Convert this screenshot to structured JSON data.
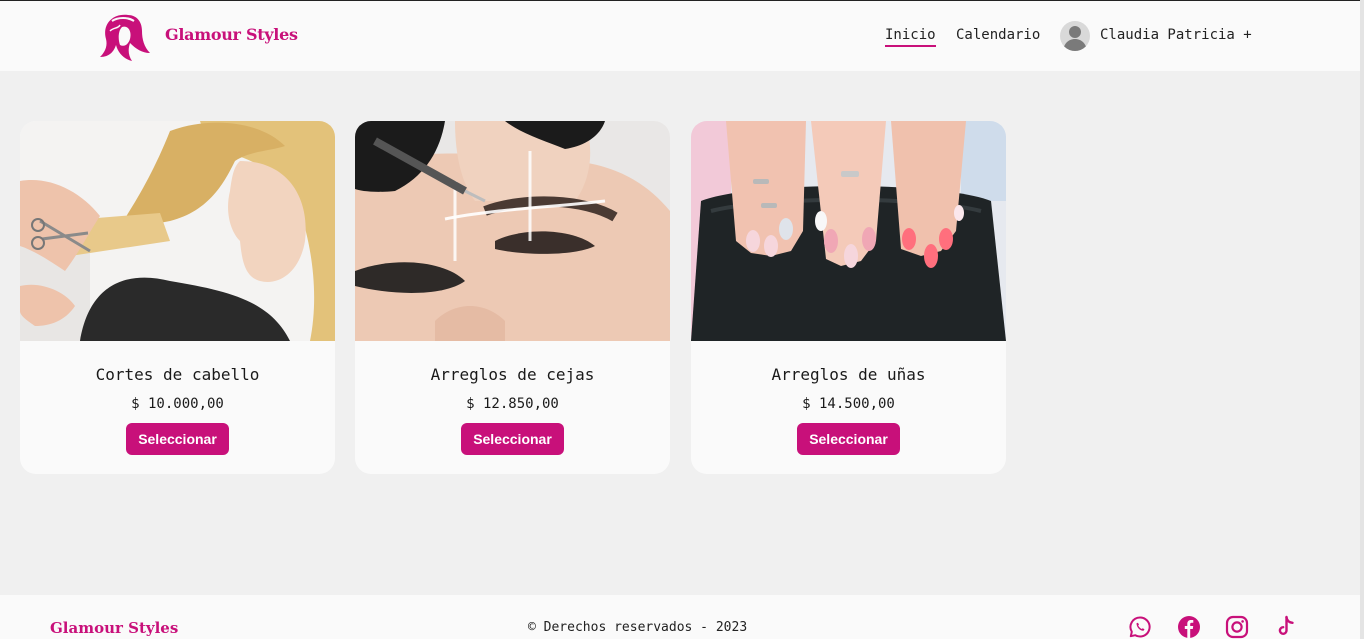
{
  "brand": "Glamour Styles",
  "nav": {
    "home": "Inicio",
    "calendar": "Calendario",
    "user": "Claudia Patricia +"
  },
  "services": [
    {
      "title": "Cortes de cabello",
      "price": "$ 10.000,00",
      "button": "Seleccionar"
    },
    {
      "title": "Arreglos de cejas",
      "price": "$ 12.850,00",
      "button": "Seleccionar"
    },
    {
      "title": "Arreglos de uñas",
      "price": "$ 14.500,00",
      "button": "Seleccionar"
    }
  ],
  "footer": {
    "brand": "Glamour Styles",
    "copyright": "© Derechos reservados - 2023",
    "social_icons": [
      "whatsapp-icon",
      "facebook-icon",
      "instagram-icon",
      "tiktok-icon"
    ]
  },
  "colors": {
    "accent": "#c8107a",
    "background": "#f0f0f0",
    "surface": "#fafafa"
  }
}
